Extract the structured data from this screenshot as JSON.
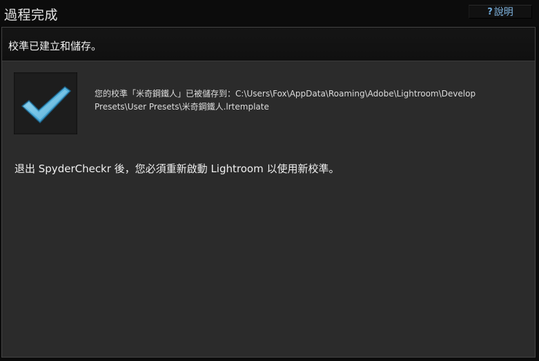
{
  "window": {
    "title": "過程完成"
  },
  "help_button": {
    "icon": "question-icon",
    "icon_glyph": "?",
    "label": "說明"
  },
  "panel": {
    "heading": "校準已建立和儲存。",
    "check_icon": "checkmark-icon",
    "saved_message": "您的校準「米奇鋼鐵人」已被儲存到：C:\\Users\\Fox\\AppData\\Roaming\\Adobe\\Lightroom\\Develop Presets\\User Presets\\米奇鋼鐵人.lrtemplate",
    "restart_message": "退出 SpyderCheckr 後，您必須重新啟動 Lightroom 以使用新校準。"
  },
  "colors": {
    "background": "#0b0b0b",
    "panel": "#2b2b2b",
    "accent": "#6ea8d8",
    "checkmark": "#5cb4dc"
  }
}
